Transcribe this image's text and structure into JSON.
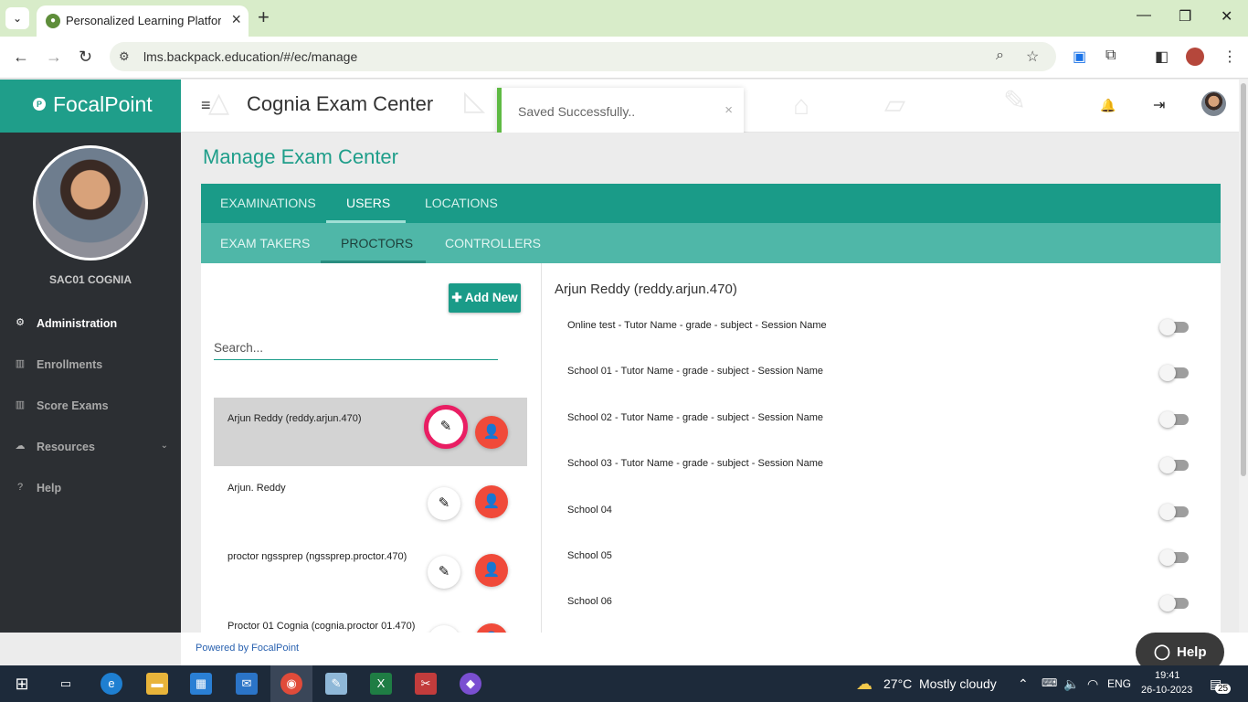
{
  "browser": {
    "tab_title": "Personalized Learning Platform",
    "url": "lms.backpack.education/#/ec/manage"
  },
  "sidebar": {
    "brand": "FocalPoint",
    "user_name": "SAC01 COGNIA",
    "items": [
      {
        "label": "Administration",
        "icon": "gear-icon"
      },
      {
        "label": "Enrollments",
        "icon": "chart-icon"
      },
      {
        "label": "Score Exams",
        "icon": "chart-icon"
      },
      {
        "label": "Resources",
        "icon": "cloud-icon"
      },
      {
        "label": "Help",
        "icon": "question-icon"
      }
    ]
  },
  "header": {
    "title": "Cognia Exam Center"
  },
  "toast": {
    "message": "Saved Successfully.."
  },
  "main": {
    "page_title": "Manage Exam Center",
    "tabs": [
      {
        "label": "EXAMINATIONS"
      },
      {
        "label": "USERS"
      },
      {
        "label": "LOCATIONS"
      }
    ],
    "subtabs": [
      {
        "label": "EXAM TAKERS"
      },
      {
        "label": "PROCTORS"
      },
      {
        "label": "CONTROLLERS"
      }
    ],
    "add_new_label": "Add New",
    "search_placeholder": "Search...",
    "proctors": [
      {
        "name": "Arjun Reddy (reddy.arjun.470)"
      },
      {
        "name": "Arjun. Reddy"
      },
      {
        "name": "proctor ngssprep (ngssprep.proctor.470)"
      },
      {
        "name": "Proctor 01 Cognia (cognia.proctor 01.470)"
      }
    ],
    "selected_proctor": "Arjun Reddy (reddy.arjun.470)",
    "sessions": [
      {
        "label": "Online test - Tutor Name - grade - subject - Session Name"
      },
      {
        "label": "School 01 - Tutor Name - grade - subject - Session Name"
      },
      {
        "label": "School 02 - Tutor Name - grade - subject - Session Name"
      },
      {
        "label": "School 03 - Tutor Name - grade - subject - Session Name"
      },
      {
        "label": "School 04"
      },
      {
        "label": "School 05"
      },
      {
        "label": "School 06"
      }
    ]
  },
  "footer": {
    "powered_by": "Powered by FocalPoint",
    "help_label": "Help"
  },
  "taskbar": {
    "weather_temp": "27°C",
    "weather_desc": "Mostly cloudy",
    "language": "ENG",
    "time": "19:41",
    "date": "26-10-2023",
    "notification_count": "25"
  },
  "colors": {
    "brand_teal": "#1f9e8a",
    "tab_teal": "#1a9b88",
    "subtab_teal": "#4fb7a8",
    "toast_success": "#5fba44",
    "danger_red": "#f04a3a",
    "focus_pink": "#e91e63"
  }
}
